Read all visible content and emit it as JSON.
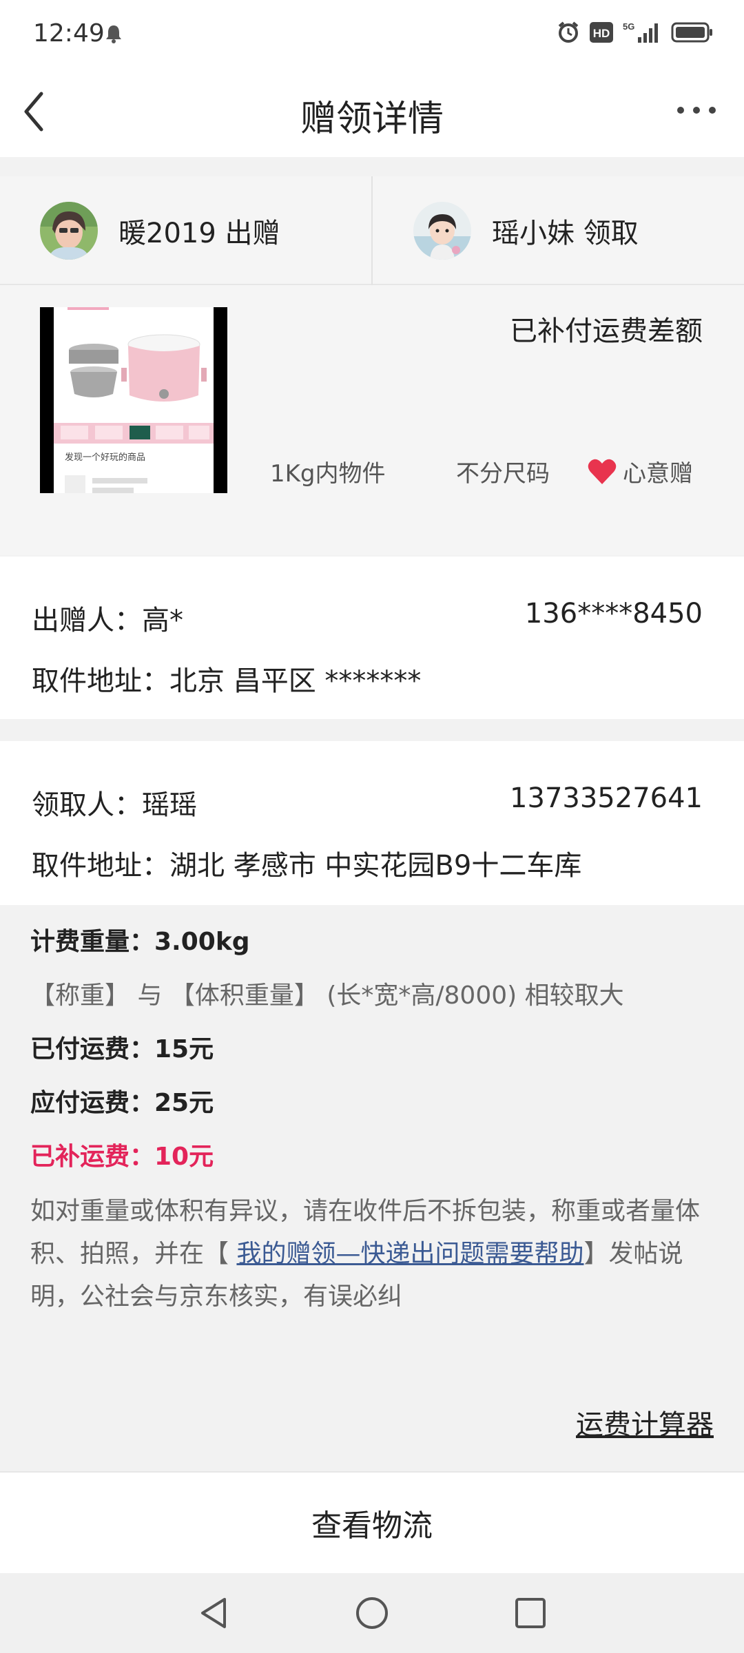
{
  "status_bar": {
    "time": "12:49",
    "hd_label": "HD",
    "network_label": "5G"
  },
  "nav": {
    "title": "赠领详情"
  },
  "users": {
    "giver": {
      "text": "暖2019 出赠"
    },
    "receiver": {
      "text": "瑶小妹 领取"
    }
  },
  "item": {
    "status": "已补付运费差额",
    "weight": "1Kg内物件",
    "size": "不分尺码",
    "gift_type": "心意赠",
    "image_caption": "发现一个好玩的商品"
  },
  "sender": {
    "name_line": "出赠人：高*",
    "phone": "136****8450",
    "address_line": "取件地址：北京 昌平区 *******"
  },
  "receiver": {
    "name_line": "领取人：瑶瑶",
    "phone": "13733527641",
    "address_line": "取件地址：湖北 孝感市 中实花园B9十二车库"
  },
  "fees": {
    "billing_weight": "计费重量：3.00kg",
    "weight_rule": "【称重】 与 【体积重量】 (长*宽*高/8000) 相较取大",
    "paid": "已付运费：15元",
    "due": "应付运费：25元",
    "supplement": "已补运费：10元",
    "notice_pre": "如对重量或体积有异议，请在收件后不拆包装，称重或者量体积、拍照，并在【 ",
    "notice_link": "我的赠领—快递出问题需要帮助",
    "notice_post": "】发帖说明，公社会与京东核实，有误必纠"
  },
  "calculator_link": "运费计算器",
  "logistics_button": "查看物流",
  "colors": {
    "accent_red": "#e3245a",
    "link_blue": "#3b5a93",
    "heart": "#e8344e"
  }
}
